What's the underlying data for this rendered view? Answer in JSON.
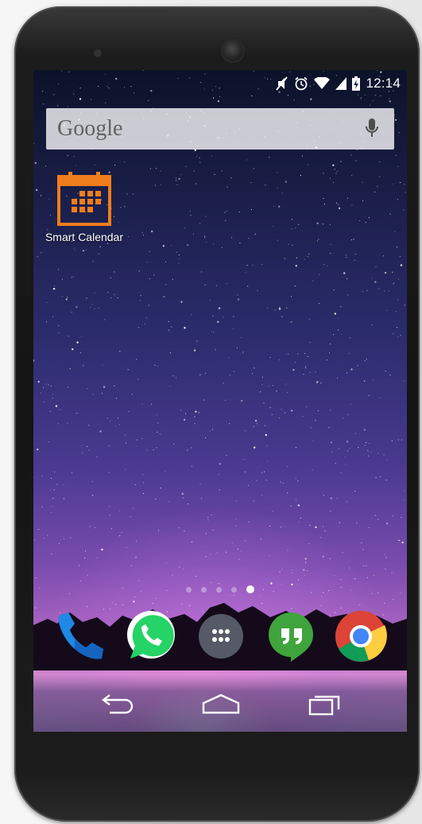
{
  "status_bar": {
    "icons": [
      "mute-icon",
      "alarm-icon",
      "wifi-icon",
      "signal-icon",
      "battery-icon"
    ],
    "time": "12:14"
  },
  "search_bar": {
    "brand": "Google",
    "mic_icon": "mic-icon"
  },
  "home_apps": [
    {
      "label": "Smart Calendar",
      "icon": "calendar-icon",
      "color": "#f07d1c"
    }
  ],
  "page_indicator": {
    "count": 5,
    "active_index": 4
  },
  "dock": [
    {
      "icon": "phone-icon",
      "color": "#1e88e5"
    },
    {
      "icon": "whatsapp-icon",
      "color": "#25d366"
    },
    {
      "icon": "app-drawer-icon",
      "color": "#555a66"
    },
    {
      "icon": "hangouts-icon",
      "color": "#3fa43c"
    },
    {
      "icon": "chrome-icon",
      "color": "#db4437"
    }
  ],
  "nav_bar": [
    "back-icon",
    "home-icon",
    "recents-icon"
  ]
}
